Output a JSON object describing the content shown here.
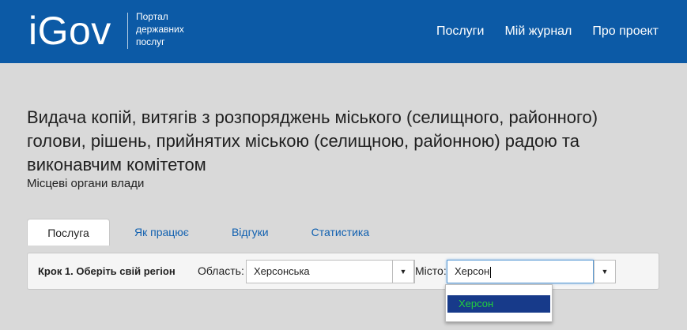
{
  "header": {
    "logo": "iGov",
    "subtitle_lines": [
      "Портал",
      "державних",
      "послуг"
    ],
    "nav": [
      "Послуги",
      "Мій журнал",
      "Про проект"
    ],
    "colors": {
      "header_bg": "#0c5aa6"
    }
  },
  "service": {
    "title": "Видача копій, витягів з розпоряджень міського (селищного, районного) голови, рішень, прийнятих міською (селищною, районною) радою та виконавчим комітетом",
    "subtitle": "Місцеві органи влади"
  },
  "tabs": [
    "Послуга",
    "Як працює",
    "Відгуки",
    "Статистика"
  ],
  "step": {
    "label": "Крок 1. Оберіть свій регіон",
    "region_label": "Область:",
    "region_value": "Херсонська",
    "city_label": "Місто:",
    "city_value": "Херсон",
    "dropdown_options": [
      "Херсон"
    ]
  },
  "icons": {
    "caret": "caret-down-icon"
  }
}
